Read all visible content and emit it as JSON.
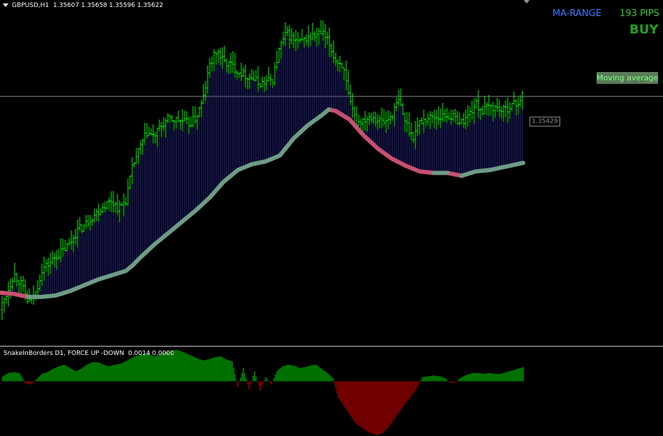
{
  "chart": {
    "symbol_header": "GBPUSD,H1  1.35607 1.35658 1.35596 1.35622",
    "indicator_header": "SnakeInBorders D1, FORCE UP -DOWN  0.0014 0.0000",
    "ma_range_label": "MA-RANGE",
    "pips_label": "193 PIPS",
    "signal_label": "BUY",
    "moving_average_label": "Moving average",
    "current_price_label": "1.35429"
  },
  "colors": {
    "background": "#000000",
    "candle": "#00ff00",
    "ma_up": "#6e9c86",
    "ma_down": "#c85070",
    "fill_up": "#2a2a9a",
    "fill_down": "#8a1010",
    "hist_up": "#00e000",
    "hist_down": "#e00000",
    "ma_range_text": "#3a7bff",
    "pips_text": "#2ecc2e",
    "buy_text": "#1fa01f",
    "ma_badge_bg": "#5a7a5a",
    "ma_badge_text": "#7dff7d"
  },
  "chart_data": {
    "type": "line",
    "price_ylim": [
      1.3375,
      1.3615
    ],
    "close_series": [
      [
        0,
        1.34
      ],
      [
        10,
        1.3412
      ],
      [
        20,
        1.3425
      ],
      [
        30,
        1.3418
      ],
      [
        40,
        1.3405
      ],
      [
        50,
        1.341
      ],
      [
        60,
        1.3428
      ],
      [
        70,
        1.3432
      ],
      [
        80,
        1.3437
      ],
      [
        90,
        1.3441
      ],
      [
        100,
        1.3446
      ],
      [
        110,
        1.3455
      ],
      [
        120,
        1.3458
      ],
      [
        130,
        1.3464
      ],
      [
        140,
        1.3468
      ],
      [
        150,
        1.3473
      ],
      [
        160,
        1.3476
      ],
      [
        170,
        1.347
      ],
      [
        180,
        1.3476
      ],
      [
        190,
        1.35
      ],
      [
        200,
        1.3512
      ],
      [
        210,
        1.3523
      ],
      [
        220,
        1.352
      ],
      [
        230,
        1.3527
      ],
      [
        240,
        1.3532
      ],
      [
        250,
        1.3532
      ],
      [
        260,
        1.3531
      ],
      [
        270,
        1.3529
      ],
      [
        280,
        1.3533
      ],
      [
        290,
        1.3545
      ],
      [
        300,
        1.357
      ],
      [
        310,
        1.358
      ],
      [
        320,
        1.3572
      ],
      [
        330,
        1.357
      ],
      [
        340,
        1.3566
      ],
      [
        350,
        1.3563
      ],
      [
        360,
        1.3561
      ],
      [
        370,
        1.3557
      ],
      [
        380,
        1.3558
      ],
      [
        390,
        1.356
      ],
      [
        400,
        1.3582
      ],
      [
        410,
        1.3592
      ],
      [
        420,
        1.3587
      ],
      [
        430,
        1.3585
      ],
      [
        440,
        1.3589
      ],
      [
        450,
        1.359
      ],
      [
        460,
        1.3592
      ],
      [
        470,
        1.3585
      ],
      [
        480,
        1.3573
      ],
      [
        490,
        1.357
      ],
      [
        500,
        1.3543
      ],
      [
        510,
        1.353
      ],
      [
        520,
        1.3532
      ],
      [
        530,
        1.3535
      ],
      [
        540,
        1.3532
      ],
      [
        550,
        1.353
      ],
      [
        560,
        1.3535
      ],
      [
        570,
        1.3545
      ],
      [
        580,
        1.353
      ],
      [
        590,
        1.352
      ],
      [
        600,
        1.353
      ],
      [
        610,
        1.3533
      ],
      [
        620,
        1.3534
      ],
      [
        630,
        1.3534
      ],
      [
        640,
        1.3535
      ],
      [
        650,
        1.3533
      ],
      [
        660,
        1.353
      ],
      [
        670,
        1.3535
      ],
      [
        680,
        1.3543
      ],
      [
        690,
        1.3538
      ],
      [
        700,
        1.3541
      ],
      [
        710,
        1.354
      ],
      [
        720,
        1.3538
      ],
      [
        730,
        1.3542
      ],
      [
        740,
        1.3543
      ],
      [
        748,
        1.355
      ]
    ],
    "moving_average": [
      [
        0,
        1.3412
      ],
      [
        20,
        1.3411
      ],
      [
        40,
        1.3409
      ],
      [
        60,
        1.3409
      ],
      [
        80,
        1.341
      ],
      [
        100,
        1.3413
      ],
      [
        120,
        1.3417
      ],
      [
        140,
        1.3421
      ],
      [
        160,
        1.3424
      ],
      [
        180,
        1.3427
      ],
      [
        190,
        1.3431
      ],
      [
        200,
        1.3436
      ],
      [
        220,
        1.3445
      ],
      [
        240,
        1.3453
      ],
      [
        260,
        1.3461
      ],
      [
        280,
        1.3469
      ],
      [
        300,
        1.3478
      ],
      [
        320,
        1.3489
      ],
      [
        340,
        1.3497
      ],
      [
        360,
        1.3501
      ],
      [
        380,
        1.3503
      ],
      [
        400,
        1.3507
      ],
      [
        420,
        1.3519
      ],
      [
        440,
        1.3528
      ],
      [
        460,
        1.3535
      ],
      [
        470,
        1.3539
      ],
      [
        480,
        1.3538
      ],
      [
        500,
        1.3532
      ],
      [
        520,
        1.3521
      ],
      [
        540,
        1.3512
      ],
      [
        560,
        1.3505
      ],
      [
        580,
        1.35
      ],
      [
        600,
        1.3496
      ],
      [
        620,
        1.3495
      ],
      [
        640,
        1.3495
      ],
      [
        660,
        1.3493
      ],
      [
        680,
        1.3496
      ],
      [
        700,
        1.3497
      ],
      [
        720,
        1.3499
      ],
      [
        748,
        1.3502
      ]
    ],
    "histogram_ylim": [
      -0.00132,
      0.00082
    ],
    "histogram": [
      [
        4,
        0.00012
      ],
      [
        12,
        0.0002
      ],
      [
        20,
        0.00022
      ],
      [
        28,
        0.0002
      ],
      [
        36,
        -4e-05
      ],
      [
        44,
        -8e-05
      ],
      [
        52,
        4e-05
      ],
      [
        60,
        0.00018
      ],
      [
        68,
        0.00022
      ],
      [
        76,
        0.0003
      ],
      [
        84,
        0.00036
      ],
      [
        92,
        0.0004
      ],
      [
        100,
        0.00032
      ],
      [
        108,
        0.00024
      ],
      [
        116,
        0.0003
      ],
      [
        124,
        0.0004
      ],
      [
        132,
        0.00046
      ],
      [
        140,
        0.00046
      ],
      [
        148,
        0.0004
      ],
      [
        156,
        0.00036
      ],
      [
        164,
        0.0004
      ],
      [
        172,
        0.00042
      ],
      [
        180,
        0.00048
      ],
      [
        188,
        0.00056
      ],
      [
        196,
        0.00062
      ],
      [
        204,
        0.00066
      ],
      [
        212,
        0.00066
      ],
      [
        220,
        0.0006
      ],
      [
        228,
        0.00064
      ],
      [
        236,
        0.0007
      ],
      [
        244,
        0.00072
      ],
      [
        252,
        0.00076
      ],
      [
        260,
        0.00072
      ],
      [
        268,
        0.00066
      ],
      [
        276,
        0.0006
      ],
      [
        284,
        0.00054
      ],
      [
        292,
        0.0005
      ],
      [
        300,
        0.00054
      ],
      [
        308,
        0.00058
      ],
      [
        316,
        0.0006
      ],
      [
        324,
        0.00052
      ],
      [
        332,
        0.00048
      ],
      [
        340,
        -0.00014
      ],
      [
        348,
        0.00032
      ],
      [
        356,
        -0.0002
      ],
      [
        364,
        0.00024
      ],
      [
        372,
        -0.00022
      ],
      [
        380,
        0.0001
      ],
      [
        388,
        -8e-05
      ],
      [
        396,
        0.00024
      ],
      [
        404,
        0.00036
      ],
      [
        412,
        0.0004
      ],
      [
        420,
        0.00038
      ],
      [
        428,
        0.00032
      ],
      [
        436,
        0.00034
      ],
      [
        444,
        0.00038
      ],
      [
        452,
        0.0004
      ],
      [
        460,
        0.0003
      ],
      [
        468,
        0.0002
      ],
      [
        476,
        8e-05
      ],
      [
        484,
        -0.0004
      ],
      [
        492,
        -0.0006
      ],
      [
        500,
        -0.0008
      ],
      [
        508,
        -0.001
      ],
      [
        516,
        -0.0011
      ],
      [
        524,
        -0.0012
      ],
      [
        532,
        -0.00126
      ],
      [
        540,
        -0.0013
      ],
      [
        548,
        -0.00124
      ],
      [
        556,
        -0.0011
      ],
      [
        564,
        -0.0009
      ],
      [
        572,
        -0.00072
      ],
      [
        580,
        -0.00052
      ],
      [
        588,
        -0.00036
      ],
      [
        596,
        -0.00016
      ],
      [
        604,
        0.0001
      ],
      [
        612,
        0.00012
      ],
      [
        620,
        0.00014
      ],
      [
        628,
        0.00012
      ],
      [
        636,
        8e-05
      ],
      [
        644,
        -4e-05
      ],
      [
        652,
        -2e-05
      ],
      [
        660,
        0.0001
      ],
      [
        668,
        0.00016
      ],
      [
        676,
        0.0002
      ],
      [
        684,
        0.0002
      ],
      [
        692,
        0.00018
      ],
      [
        700,
        0.0002
      ],
      [
        708,
        0.00018
      ],
      [
        716,
        0.00018
      ],
      [
        724,
        0.00022
      ],
      [
        732,
        0.00026
      ],
      [
        740,
        0.0003
      ],
      [
        748,
        0.00034
      ]
    ]
  }
}
